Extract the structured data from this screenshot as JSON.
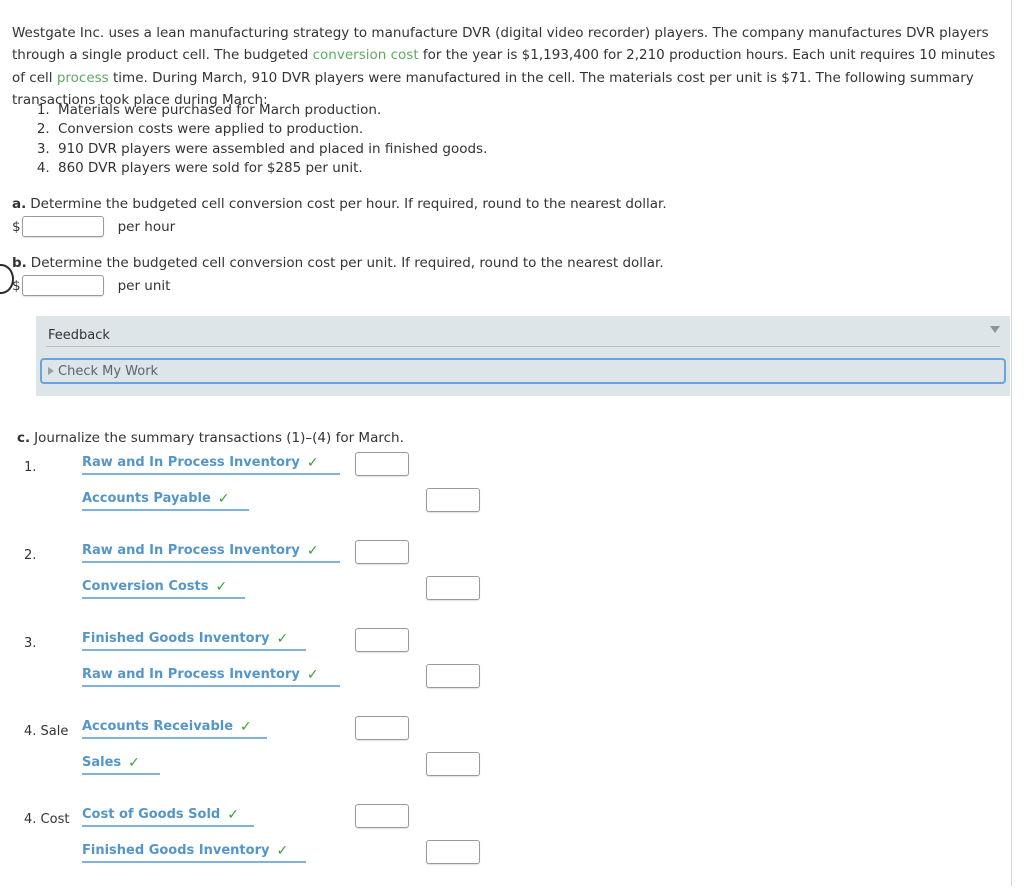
{
  "problem": {
    "intro_parts": [
      {
        "text": "Westgate Inc. uses a lean manufacturing strategy to manufacture DVR (digital video recorder) players. The company manufactures DVR players through a single product cell. The budgeted ",
        "style": "plain"
      },
      {
        "text": "conversion cost",
        "style": "green-link"
      },
      {
        "text": " for the year is $1,193,400 for 2,210 production hours. Each unit requires 10 minutes of cell ",
        "style": "plain"
      },
      {
        "text": "process",
        "style": "green-link"
      },
      {
        "text": " time. During March, 910 DVR players were manufactured in the cell. The materials cost per unit is $71. The following summary transactions took place during March:",
        "style": "plain"
      }
    ],
    "transactions": [
      "Materials were purchased for March production.",
      "Conversion costs were applied to production.",
      "910 DVR players were assembled and placed in finished goods.",
      "860 DVR players were sold for $285 per unit."
    ]
  },
  "part_a": {
    "letter": "a.",
    "prompt": "Determine the budgeted cell conversion cost per hour. If required, round to the nearest dollar.",
    "currency_symbol": "$",
    "input_value": "",
    "input_placeholder": "",
    "unit_label": "per hour"
  },
  "part_b": {
    "letter": "b.",
    "prompt": "Determine the budgeted cell conversion cost per unit. If required, round to the nearest dollar.",
    "currency_symbol": "$",
    "input_value": "",
    "input_placeholder": "",
    "unit_label": "per unit"
  },
  "feedback": {
    "title": "Feedback",
    "check_my_work_label": "Check My Work",
    "collapse_icon": "triangle-down-icon",
    "expand_icon": "triangle-right-icon"
  },
  "part_c": {
    "letter": "c.",
    "prompt": "Journalize the summary transactions (1)–(4) for March.",
    "check_icon": "check-mark-icon",
    "entries": [
      {
        "number": "1.",
        "lines": [
          {
            "account": "Raw and In Process Inventory",
            "verified": true,
            "side": "debit",
            "value": "",
            "box_width_hint": 258
          },
          {
            "account": "Accounts Payable",
            "verified": true,
            "side": "credit",
            "value": "",
            "box_width_hint": 167
          }
        ]
      },
      {
        "number": "2.",
        "lines": [
          {
            "account": "Raw and In Process Inventory",
            "verified": true,
            "side": "debit",
            "value": "",
            "box_width_hint": 258
          },
          {
            "account": "Conversion Costs",
            "verified": true,
            "side": "credit",
            "value": "",
            "box_width_hint": 163
          }
        ]
      },
      {
        "number": "3.",
        "lines": [
          {
            "account": "Finished Goods Inventory",
            "verified": true,
            "side": "debit",
            "value": "",
            "box_width_hint": 224
          },
          {
            "account": "Raw and In Process Inventory",
            "verified": true,
            "side": "credit",
            "value": "",
            "box_width_hint": 258
          }
        ]
      },
      {
        "number": "4. Sale",
        "lines": [
          {
            "account": "Accounts Receivable",
            "verified": true,
            "side": "debit",
            "value": "",
            "box_width_hint": 185
          },
          {
            "account": "Sales",
            "verified": true,
            "side": "credit",
            "value": "",
            "box_width_hint": 73
          }
        ]
      },
      {
        "number": "4. Cost",
        "lines": [
          {
            "account": "Cost of Goods Sold",
            "verified": true,
            "side": "debit",
            "value": "",
            "box_width_hint": 172
          },
          {
            "account": "Finished Goods Inventory",
            "verified": true,
            "side": "credit",
            "value": "",
            "box_width_hint": 224
          }
        ]
      }
    ]
  },
  "colors": {
    "account_link": "#5596c8",
    "account_underline": "#7fb4da",
    "check_green": "#3aa03a",
    "inline_link_green": "#5faa63",
    "feedback_bg": "#dde5e8",
    "cmw_border": "#6aa4e0",
    "text": "#333333"
  }
}
